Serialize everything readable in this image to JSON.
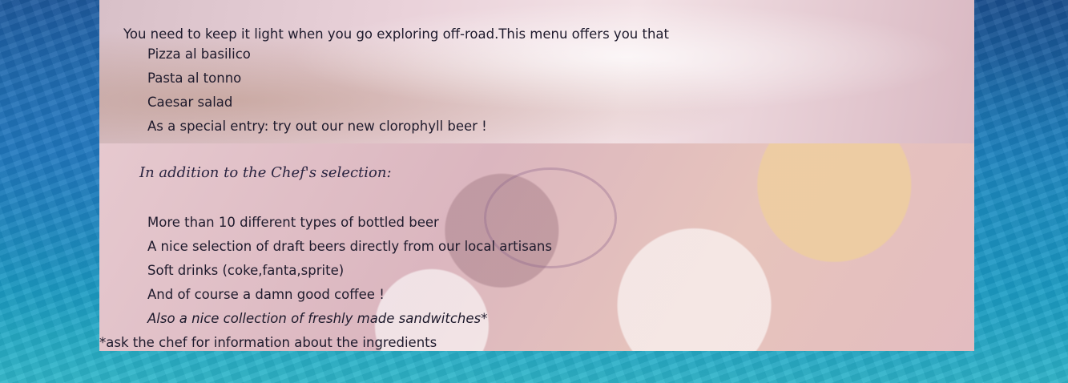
{
  "intro": "You need to keep it light when you go exploring off-road.This menu offers you that",
  "menu_items": [
    "Pizza al basilico",
    "Pasta al tonno",
    "Caesar salad",
    "As a special entry: try out our new clorophyll beer !"
  ],
  "selection_heading": "In addition to the Chef's selection:",
  "extras": [
    "More than 10 different types of bottled beer",
    "A nice selection of draft beers directly from our local artisans",
    "Soft drinks (coke,fanta,sprite)",
    "And of course a damn good coffee !",
    "Also a nice collection of freshly made sandwitches*"
  ],
  "footnote": "*ask the chef for information about the ingredients"
}
